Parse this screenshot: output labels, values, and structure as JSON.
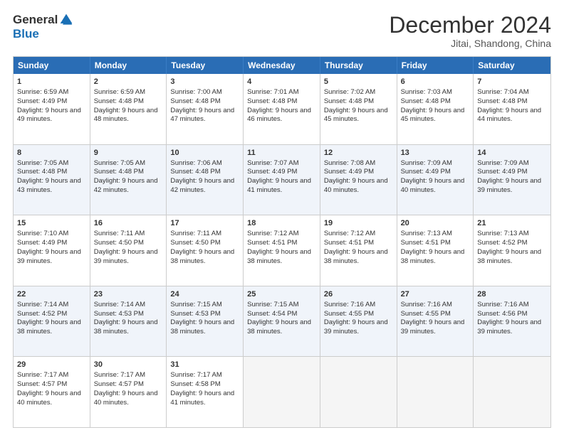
{
  "logo": {
    "general": "General",
    "blue": "Blue"
  },
  "header": {
    "month": "December 2024",
    "location": "Jitai, Shandong, China"
  },
  "days": [
    "Sunday",
    "Monday",
    "Tuesday",
    "Wednesday",
    "Thursday",
    "Friday",
    "Saturday"
  ],
  "rows": [
    [
      {
        "day": "1",
        "sunrise": "Sunrise: 6:59 AM",
        "sunset": "Sunset: 4:49 PM",
        "daylight": "Daylight: 9 hours and 49 minutes."
      },
      {
        "day": "2",
        "sunrise": "Sunrise: 6:59 AM",
        "sunset": "Sunset: 4:48 PM",
        "daylight": "Daylight: 9 hours and 48 minutes."
      },
      {
        "day": "3",
        "sunrise": "Sunrise: 7:00 AM",
        "sunset": "Sunset: 4:48 PM",
        "daylight": "Daylight: 9 hours and 47 minutes."
      },
      {
        "day": "4",
        "sunrise": "Sunrise: 7:01 AM",
        "sunset": "Sunset: 4:48 PM",
        "daylight": "Daylight: 9 hours and 46 minutes."
      },
      {
        "day": "5",
        "sunrise": "Sunrise: 7:02 AM",
        "sunset": "Sunset: 4:48 PM",
        "daylight": "Daylight: 9 hours and 45 minutes."
      },
      {
        "day": "6",
        "sunrise": "Sunrise: 7:03 AM",
        "sunset": "Sunset: 4:48 PM",
        "daylight": "Daylight: 9 hours and 45 minutes."
      },
      {
        "day": "7",
        "sunrise": "Sunrise: 7:04 AM",
        "sunset": "Sunset: 4:48 PM",
        "daylight": "Daylight: 9 hours and 44 minutes."
      }
    ],
    [
      {
        "day": "8",
        "sunrise": "Sunrise: 7:05 AM",
        "sunset": "Sunset: 4:48 PM",
        "daylight": "Daylight: 9 hours and 43 minutes."
      },
      {
        "day": "9",
        "sunrise": "Sunrise: 7:05 AM",
        "sunset": "Sunset: 4:48 PM",
        "daylight": "Daylight: 9 hours and 42 minutes."
      },
      {
        "day": "10",
        "sunrise": "Sunrise: 7:06 AM",
        "sunset": "Sunset: 4:48 PM",
        "daylight": "Daylight: 9 hours and 42 minutes."
      },
      {
        "day": "11",
        "sunrise": "Sunrise: 7:07 AM",
        "sunset": "Sunset: 4:49 PM",
        "daylight": "Daylight: 9 hours and 41 minutes."
      },
      {
        "day": "12",
        "sunrise": "Sunrise: 7:08 AM",
        "sunset": "Sunset: 4:49 PM",
        "daylight": "Daylight: 9 hours and 40 minutes."
      },
      {
        "day": "13",
        "sunrise": "Sunrise: 7:09 AM",
        "sunset": "Sunset: 4:49 PM",
        "daylight": "Daylight: 9 hours and 40 minutes."
      },
      {
        "day": "14",
        "sunrise": "Sunrise: 7:09 AM",
        "sunset": "Sunset: 4:49 PM",
        "daylight": "Daylight: 9 hours and 39 minutes."
      }
    ],
    [
      {
        "day": "15",
        "sunrise": "Sunrise: 7:10 AM",
        "sunset": "Sunset: 4:49 PM",
        "daylight": "Daylight: 9 hours and 39 minutes."
      },
      {
        "day": "16",
        "sunrise": "Sunrise: 7:11 AM",
        "sunset": "Sunset: 4:50 PM",
        "daylight": "Daylight: 9 hours and 39 minutes."
      },
      {
        "day": "17",
        "sunrise": "Sunrise: 7:11 AM",
        "sunset": "Sunset: 4:50 PM",
        "daylight": "Daylight: 9 hours and 38 minutes."
      },
      {
        "day": "18",
        "sunrise": "Sunrise: 7:12 AM",
        "sunset": "Sunset: 4:51 PM",
        "daylight": "Daylight: 9 hours and 38 minutes."
      },
      {
        "day": "19",
        "sunrise": "Sunrise: 7:12 AM",
        "sunset": "Sunset: 4:51 PM",
        "daylight": "Daylight: 9 hours and 38 minutes."
      },
      {
        "day": "20",
        "sunrise": "Sunrise: 7:13 AM",
        "sunset": "Sunset: 4:51 PM",
        "daylight": "Daylight: 9 hours and 38 minutes."
      },
      {
        "day": "21",
        "sunrise": "Sunrise: 7:13 AM",
        "sunset": "Sunset: 4:52 PM",
        "daylight": "Daylight: 9 hours and 38 minutes."
      }
    ],
    [
      {
        "day": "22",
        "sunrise": "Sunrise: 7:14 AM",
        "sunset": "Sunset: 4:52 PM",
        "daylight": "Daylight: 9 hours and 38 minutes."
      },
      {
        "day": "23",
        "sunrise": "Sunrise: 7:14 AM",
        "sunset": "Sunset: 4:53 PM",
        "daylight": "Daylight: 9 hours and 38 minutes."
      },
      {
        "day": "24",
        "sunrise": "Sunrise: 7:15 AM",
        "sunset": "Sunset: 4:53 PM",
        "daylight": "Daylight: 9 hours and 38 minutes."
      },
      {
        "day": "25",
        "sunrise": "Sunrise: 7:15 AM",
        "sunset": "Sunset: 4:54 PM",
        "daylight": "Daylight: 9 hours and 38 minutes."
      },
      {
        "day": "26",
        "sunrise": "Sunrise: 7:16 AM",
        "sunset": "Sunset: 4:55 PM",
        "daylight": "Daylight: 9 hours and 39 minutes."
      },
      {
        "day": "27",
        "sunrise": "Sunrise: 7:16 AM",
        "sunset": "Sunset: 4:55 PM",
        "daylight": "Daylight: 9 hours and 39 minutes."
      },
      {
        "day": "28",
        "sunrise": "Sunrise: 7:16 AM",
        "sunset": "Sunset: 4:56 PM",
        "daylight": "Daylight: 9 hours and 39 minutes."
      }
    ],
    [
      {
        "day": "29",
        "sunrise": "Sunrise: 7:17 AM",
        "sunset": "Sunset: 4:57 PM",
        "daylight": "Daylight: 9 hours and 40 minutes."
      },
      {
        "day": "30",
        "sunrise": "Sunrise: 7:17 AM",
        "sunset": "Sunset: 4:57 PM",
        "daylight": "Daylight: 9 hours and 40 minutes."
      },
      {
        "day": "31",
        "sunrise": "Sunrise: 7:17 AM",
        "sunset": "Sunset: 4:58 PM",
        "daylight": "Daylight: 9 hours and 41 minutes."
      },
      null,
      null,
      null,
      null
    ]
  ]
}
